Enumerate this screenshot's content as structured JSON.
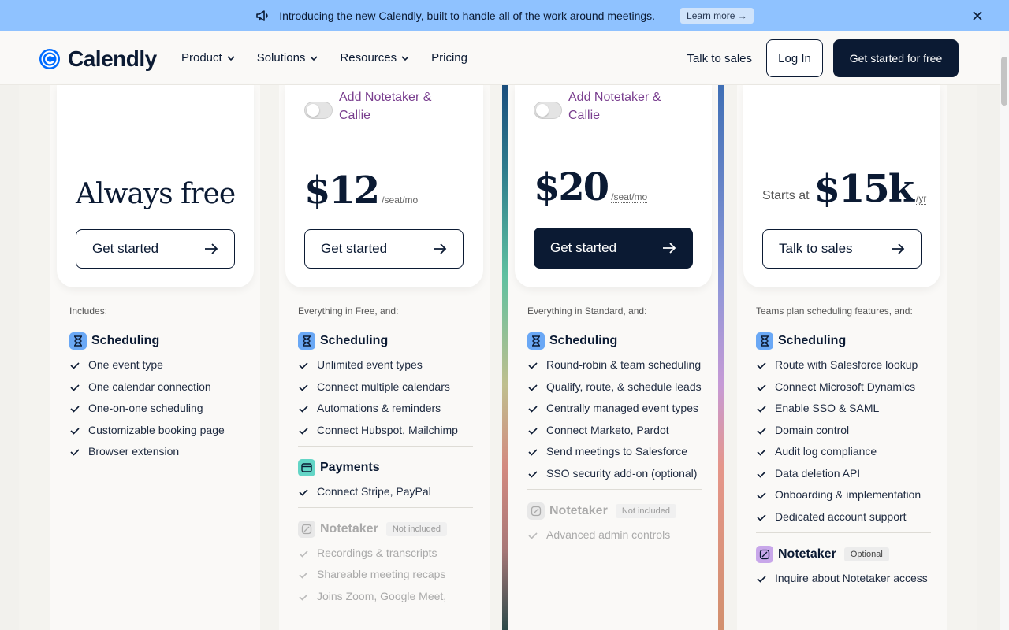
{
  "announcement": {
    "text": "Introducing the new Calendly, built to handle all of the work around meetings.",
    "learn_more": "Learn more →"
  },
  "nav": {
    "logo": "Calendly",
    "menu": [
      "Product",
      "Solutions",
      "Resources",
      "Pricing"
    ],
    "talk_to_sales": "Talk to sales",
    "login": "Log In",
    "get_started": "Get started for free"
  },
  "plans": [
    {
      "price_text": "Always free",
      "button": "Get started",
      "intro": "Includes:",
      "sections": [
        {
          "title": "Scheduling",
          "items": [
            "One event type",
            "One calendar connection",
            "One-on-one scheduling",
            "Customizable booking page",
            "Browser extension"
          ]
        }
      ]
    },
    {
      "toggle_label": "Add Notetaker & Callie",
      "price": "$12",
      "unit": "/seat/mo",
      "button": "Get started",
      "intro": "Everything in Free, and:",
      "sections": [
        {
          "title": "Scheduling",
          "items": [
            "Unlimited event types",
            "Connect multiple calendars",
            "Automations & reminders",
            "Connect Hubspot, Mailchimp"
          ]
        },
        {
          "title": "Payments",
          "items": [
            "Connect Stripe, PayPal"
          ]
        },
        {
          "title": "Notetaker",
          "badge": "Not included",
          "items": [
            "Recordings & transcripts",
            "Shareable meeting recaps",
            "Joins Zoom, Google Meet,"
          ]
        }
      ]
    },
    {
      "toggle_label": "Add Notetaker & Callie",
      "price": "$20",
      "unit": "/seat/mo",
      "button": "Get started",
      "intro": "Everything in Standard, and:",
      "sections": [
        {
          "title": "Scheduling",
          "items": [
            "Round-robin & team scheduling",
            "Qualify, route, & schedule leads",
            "Centrally managed event types",
            "Connect Marketo, Pardot",
            "Send meetings to Salesforce",
            "SSO security add-on (optional)"
          ]
        },
        {
          "title": "Notetaker",
          "badge": "Not included",
          "items": [
            "Advanced admin controls"
          ]
        }
      ]
    },
    {
      "starts_at": "Starts at",
      "price": "$15k",
      "unit": "/yr",
      "button": "Talk to sales",
      "intro": "Teams plan scheduling features, and:",
      "sections": [
        {
          "title": "Scheduling",
          "items": [
            "Route with Salesforce lookup",
            "Connect Microsoft Dynamics",
            "Enable SSO & SAML",
            "Domain control",
            "Audit log compliance",
            "Data deletion API",
            "Onboarding & implementation",
            "Dedicated account support"
          ]
        },
        {
          "title": "Notetaker",
          "badge": "Optional",
          "items": [
            "Inquire about Notetaker access"
          ]
        }
      ]
    }
  ]
}
